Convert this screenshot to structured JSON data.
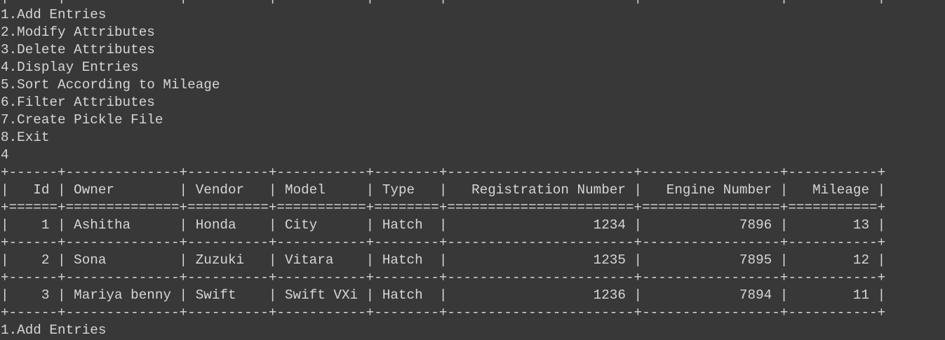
{
  "terminal": {
    "menu": [
      "1.Add Entries",
      "2.Modify Attributes",
      "3.Delete Attributes",
      "4.Display Entries",
      "5.Sort According to Mileage",
      "6.Filter Attributes",
      "7.Create Pickle File",
      "8.Exit"
    ],
    "input": "4",
    "trailing_line": "1.Add Entries"
  },
  "table": {
    "columns": [
      "Id",
      "Owner",
      "Vendor",
      "Model",
      "Type",
      "Registration Number",
      "Engine Number",
      "Mileage"
    ],
    "rows": [
      [
        "1",
        "Ashitha",
        "Honda",
        "City",
        "Hatch",
        "1234",
        "7896",
        "13"
      ],
      [
        "2",
        "Sona",
        "Zuzuki",
        "Vitara",
        "Hatch",
        "1235",
        "7895",
        "12"
      ],
      [
        "3",
        "Mariya benny",
        "Swift",
        "Swift VXi",
        "Hatch",
        "1236",
        "7894",
        "11"
      ]
    ]
  }
}
